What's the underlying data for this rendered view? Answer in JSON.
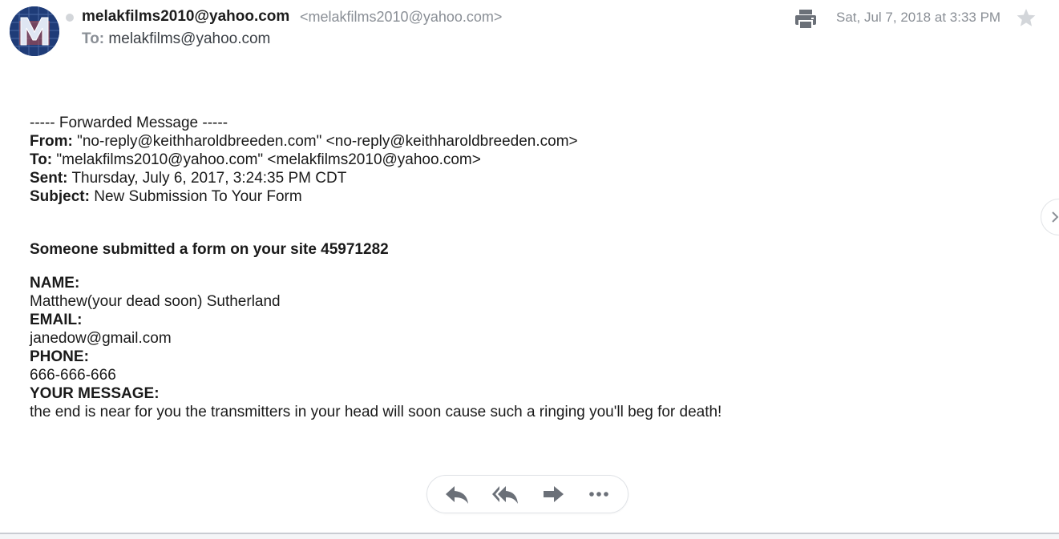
{
  "header": {
    "sender_name": "melakfilms2010@yahoo.com",
    "sender_email": "<melakfilms2010@yahoo.com>",
    "to_label": "To:",
    "to_value": "melakfilms@yahoo.com",
    "date": "Sat, Jul 7, 2018 at 3:33 PM"
  },
  "message": {
    "forwarded_banner": "----- Forwarded Message -----",
    "from_label": "From:",
    "from_value": "\"no-reply@keithharoldbreeden.com\" <no-reply@keithharoldbreeden.com>",
    "to_label": "To:",
    "to_value": "\"melakfilms2010@yahoo.com\" <melakfilms2010@yahoo.com>",
    "sent_label": "Sent:",
    "sent_value": "Thursday, July 6, 2017, 3:24:35 PM CDT",
    "subject_label": "Subject:",
    "subject_value": "New Submission To Your Form",
    "heading": "Someone submitted a form on your site 45971282",
    "fields": [
      {
        "label": "NAME:",
        "value": "Matthew(your dead soon) Sutherland"
      },
      {
        "label": "EMAIL:",
        "value": "janedow@gmail.com"
      },
      {
        "label": "PHONE:",
        "value": "666-666-666"
      },
      {
        "label": "YOUR MESSAGE:",
        "value": "the end is near for you the transmitters in your head will soon cause such a ringing you'll beg for death!"
      }
    ]
  },
  "icons": {
    "avatar": "avatar-m-logo",
    "print": "print-icon",
    "star": "star-icon",
    "next": "chevron-right-icon",
    "reply": "reply-icon",
    "reply_all": "reply-all-icon",
    "forward": "forward-icon",
    "more": "more-icon"
  },
  "colors": {
    "muted_text": "#8a8f96",
    "icon_gray": "#6b7078",
    "avatar_bg": "#1f3c78"
  }
}
